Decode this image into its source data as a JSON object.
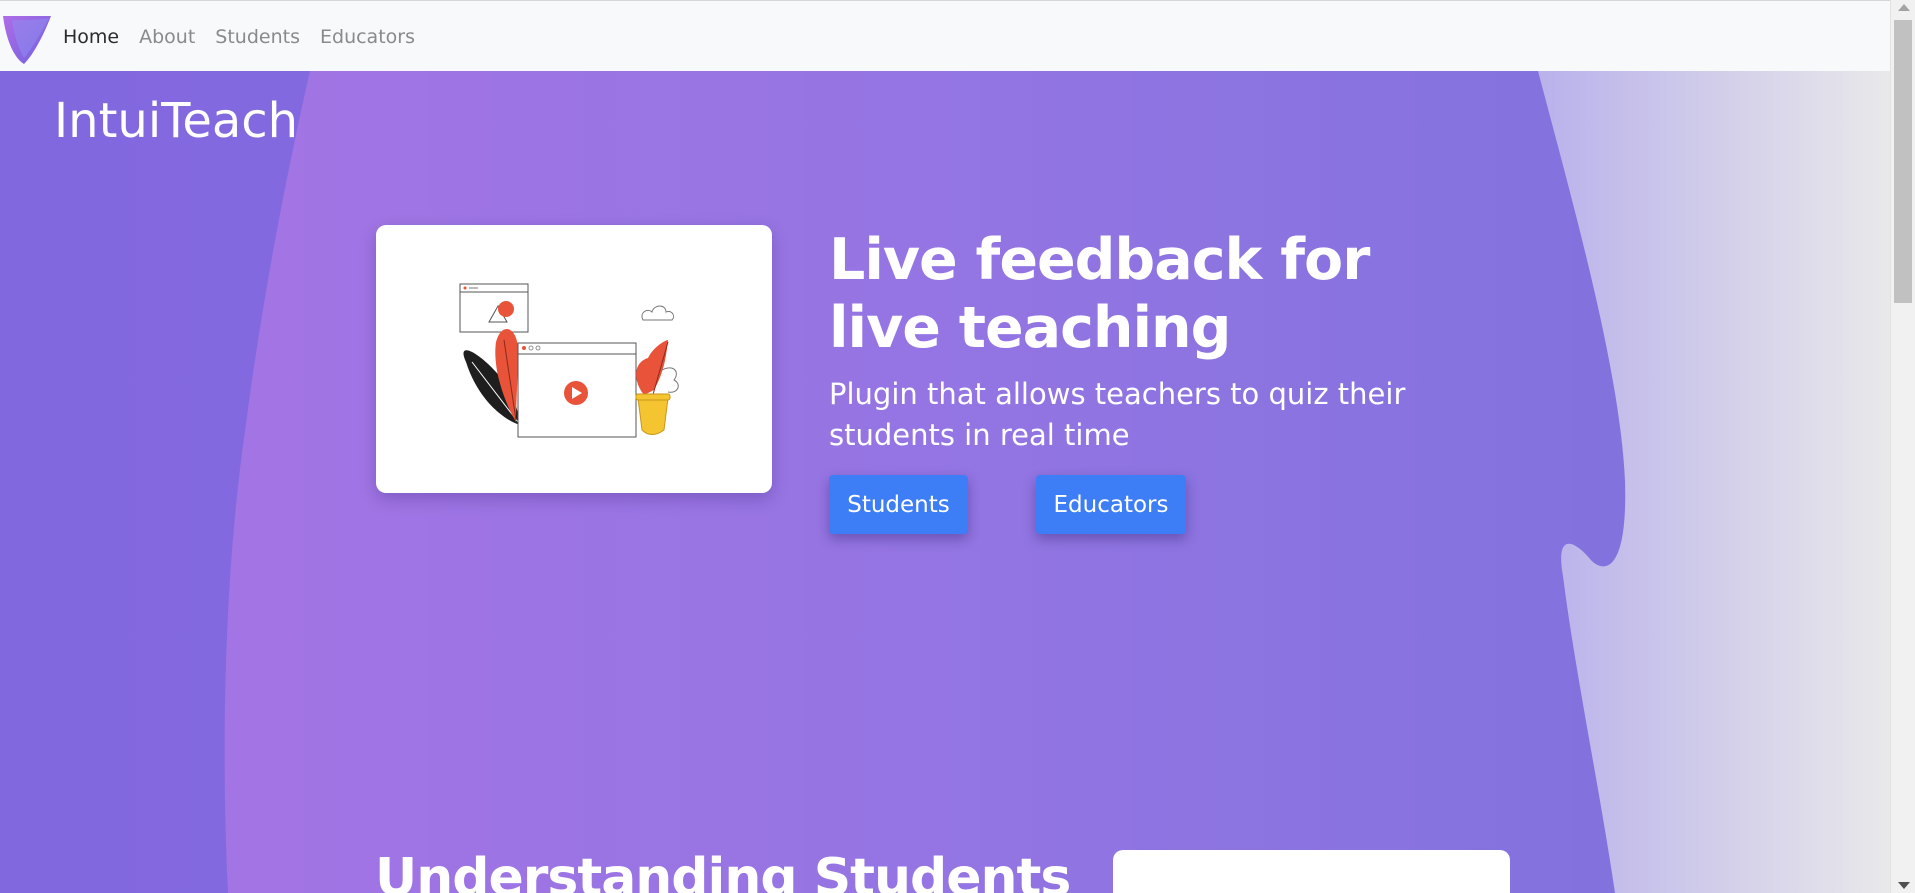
{
  "nav": {
    "items": [
      {
        "label": "Home",
        "active": true
      },
      {
        "label": "About",
        "active": false
      },
      {
        "label": "Students",
        "active": false
      },
      {
        "label": "Educators",
        "active": false
      }
    ]
  },
  "hero": {
    "brand": "IntuiTeach",
    "headline": "Live feedback for live teaching",
    "subline": "Plugin that allows teachers to quiz their students in real time",
    "buttons": {
      "students": "Students",
      "educators": "Educators"
    }
  },
  "section": {
    "title": "Understanding Students"
  },
  "colors": {
    "hero_left": "#8a6fe0",
    "hero_mid": "#9a73e3",
    "hero_right": "#7f70de",
    "button": "#3d7df5",
    "navbar": "#f8f9fa"
  },
  "icons": {
    "logo": "brand-logo-icon",
    "illustration": "video-player-illustration"
  }
}
